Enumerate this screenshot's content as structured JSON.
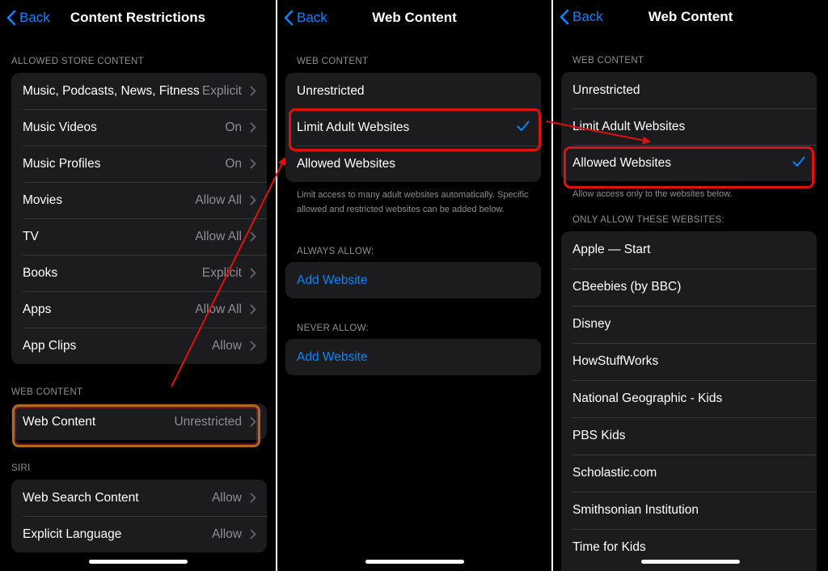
{
  "back_label": "Back",
  "colors": {
    "accent": "#0a84ff",
    "annotation": "#e01010"
  },
  "panel1": {
    "title": "Content Restrictions",
    "store_header": "ALLOWED STORE CONTENT",
    "store_items": [
      {
        "label": "Music, Podcasts, News, Fitness",
        "value": "Explicit"
      },
      {
        "label": "Music Videos",
        "value": "On"
      },
      {
        "label": "Music Profiles",
        "value": "On"
      },
      {
        "label": "Movies",
        "value": "Allow All"
      },
      {
        "label": "TV",
        "value": "Allow All"
      },
      {
        "label": "Books",
        "value": "Explicit"
      },
      {
        "label": "Apps",
        "value": "Allow All"
      },
      {
        "label": "App Clips",
        "value": "Allow"
      }
    ],
    "web_header": "WEB CONTENT",
    "web_item": {
      "label": "Web Content",
      "value": "Unrestricted"
    },
    "siri_header": "SIRI",
    "siri_items": [
      {
        "label": "Web Search Content",
        "value": "Allow"
      },
      {
        "label": "Explicit Language",
        "value": "Allow"
      }
    ]
  },
  "panel2": {
    "title": "Web Content",
    "header": "WEB CONTENT",
    "options": [
      "Unrestricted",
      "Limit Adult Websites",
      "Allowed Websites"
    ],
    "selected": "Limit Adult Websites",
    "footer": "Limit access to many adult websites automatically. Specific allowed and restricted websites can be added below.",
    "always_header": "ALWAYS ALLOW:",
    "always_add": "Add Website",
    "never_header": "NEVER ALLOW:",
    "never_add": "Add Website"
  },
  "panel3": {
    "title": "Web Content",
    "header": "WEB CONTENT",
    "options": [
      "Unrestricted",
      "Limit Adult Websites",
      "Allowed Websites"
    ],
    "selected": "Allowed Websites",
    "footer": "Allow access only to the websites below.",
    "sites_header": "ONLY ALLOW THESE WEBSITES:",
    "sites": [
      "Apple — Start",
      "CBeebies (by BBC)",
      "Disney",
      "HowStuffWorks",
      "National Geographic - Kids",
      "PBS Kids",
      "Scholastic.com",
      "Smithsonian Institution",
      "Time for Kids"
    ]
  }
}
